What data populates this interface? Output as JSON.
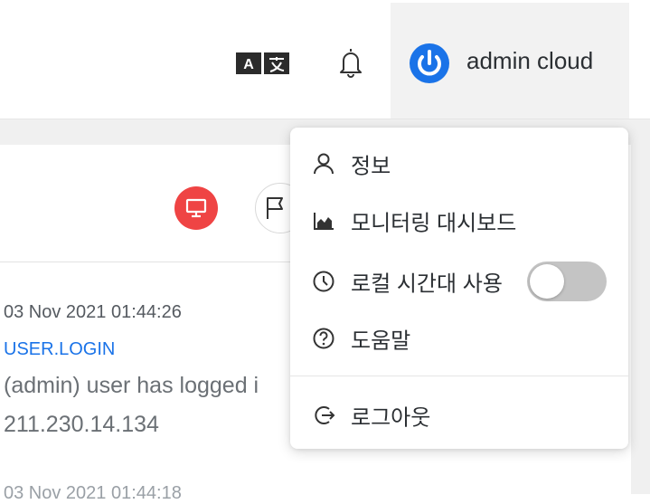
{
  "header": {
    "language_icon": "translate-icon",
    "notification_icon": "bell-icon",
    "user": {
      "avatar_icon": "power-icon",
      "name": "admin cloud",
      "avatar_color": "#1a73e8"
    }
  },
  "toolbar": {
    "monitor_icon": "monitor-icon",
    "monitor_color": "#ef4444",
    "flag_icon": "flag-icon"
  },
  "log_entry": {
    "time": "03 Nov 2021 01:44:26",
    "event": "USER.LOGIN",
    "message": "(admin) user has logged i",
    "ip": "211.230.14.134",
    "next_time": "03 Nov 2021 01:44:18"
  },
  "user_menu": {
    "items": [
      {
        "icon": "user-icon",
        "label": "정보"
      },
      {
        "icon": "area-chart-icon",
        "label": "모니터링 대시보드"
      },
      {
        "icon": "clock-icon",
        "label": "로컬 시간대 사용",
        "toggle": false
      },
      {
        "icon": "help-circle-icon",
        "label": "도움말"
      },
      {
        "icon": "logout-icon",
        "label": "로그아웃"
      }
    ]
  }
}
